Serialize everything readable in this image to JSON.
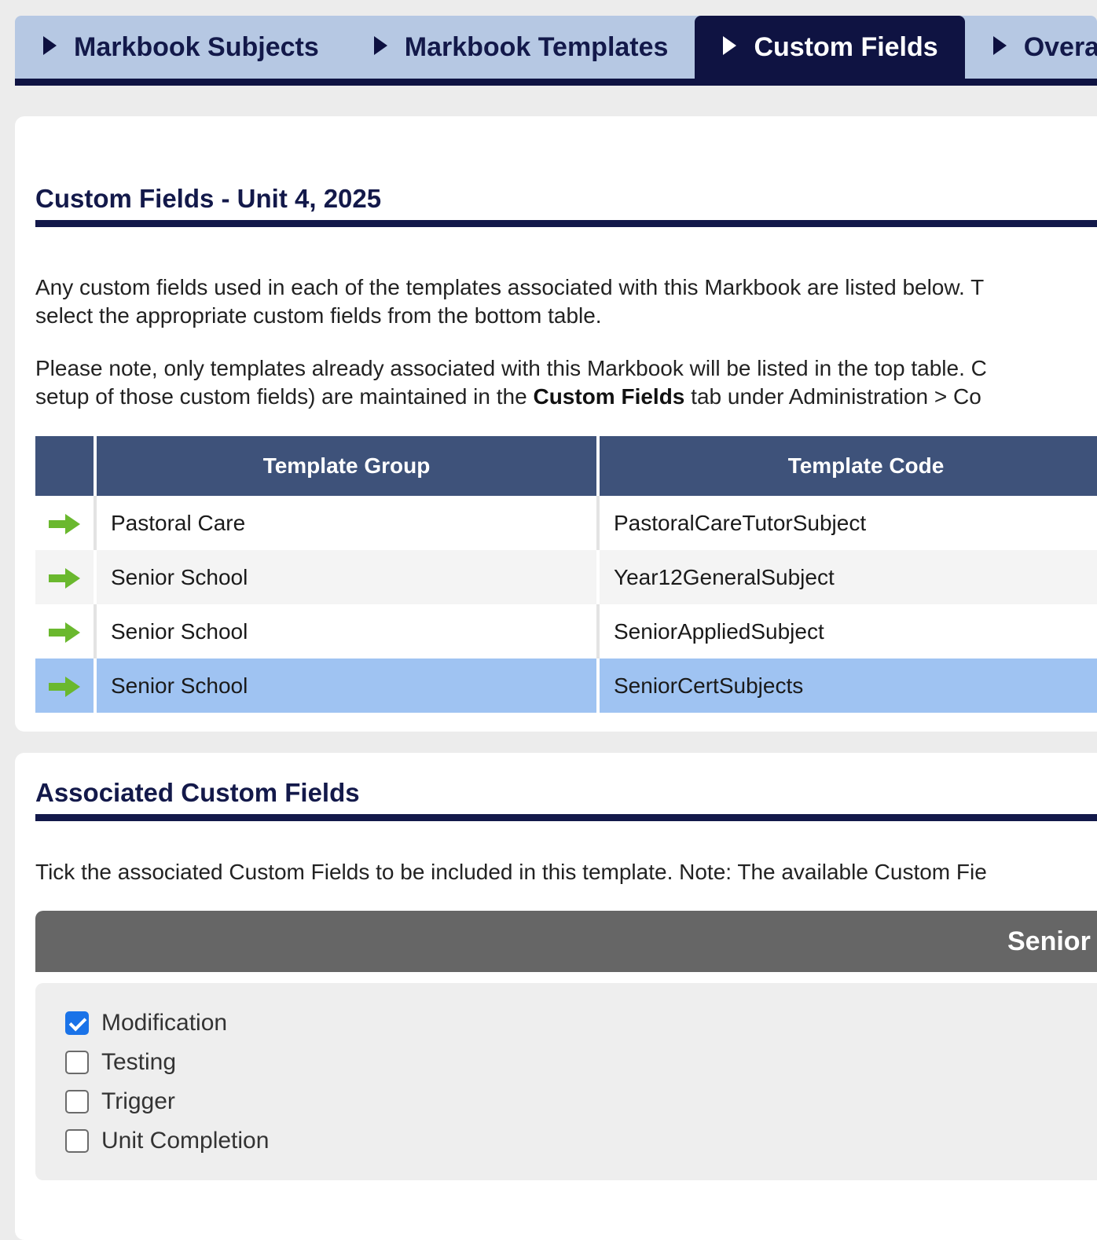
{
  "tabs": [
    {
      "label": "Markbook Subjects",
      "active": false
    },
    {
      "label": "Markbook Templates",
      "active": false
    },
    {
      "label": "Custom Fields",
      "active": true
    },
    {
      "label": "Overa",
      "active": false
    }
  ],
  "custom_fields_section": {
    "title": "Custom Fields - Unit 4, 2025",
    "intro_line1": "Any custom fields used in each of the templates associated with this Markbook are listed below. T",
    "intro_line2": "select the appropriate custom fields from the bottom table.",
    "note_line1": "Please note, only templates already associated with this Markbook will be listed in the top table. C",
    "note_line2_pre": "setup of those custom fields) are maintained in the ",
    "note_line2_bold": "Custom Fields",
    "note_line2_post": " tab under Administration > Co"
  },
  "template_table": {
    "columns": [
      "Template Group",
      "Template Code"
    ],
    "rows": [
      {
        "group": "Pastoral Care",
        "code": "PastoralCareTutorSubject",
        "selected": false
      },
      {
        "group": "Senior School",
        "code": "Year12GeneralSubject",
        "selected": false
      },
      {
        "group": "Senior School",
        "code": "SeniorAppliedSubject",
        "selected": false
      },
      {
        "group": "Senior School",
        "code": "SeniorCertSubjects",
        "selected": true
      }
    ],
    "row_icon": "green-right-arrow-icon"
  },
  "associated_section": {
    "title": "Associated Custom Fields",
    "instruction": "Tick the associated Custom Fields to be included in this template. Note: The available Custom Fie",
    "group_header": "Senior",
    "fields": [
      {
        "label": "Modification",
        "checked": true
      },
      {
        "label": "Testing",
        "checked": false
      },
      {
        "label": "Trigger",
        "checked": false
      },
      {
        "label": "Unit Completion",
        "checked": false
      }
    ]
  },
  "colors": {
    "navy": "#13194a",
    "tab_bg": "#b6c8e3",
    "table_header": "#3e527a",
    "selected_row": "#9fc3f2",
    "arrow_green": "#6ab82e",
    "checkbox_blue": "#1a73e8"
  }
}
